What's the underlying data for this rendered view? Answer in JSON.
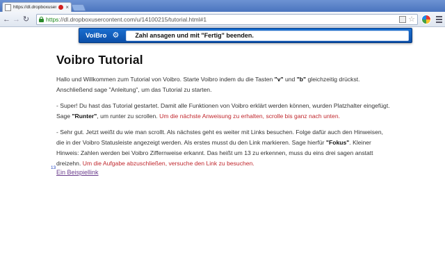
{
  "browser": {
    "tab_title": "https://dl.dropboxuser",
    "tab_close": "×",
    "url_https": "https",
    "url_rest": "://dl.dropboxusercontent.com/u/14100215/tutorial.html#1"
  },
  "voibro": {
    "logo": "VoiBro",
    "status": "Zahl ansagen und mit \"Fertig\" beenden."
  },
  "page": {
    "title": "Voibro Tutorial",
    "p1": {
      "t1": "Hallo und Willkommen zum Tutorial von Voibro. Starte Voibro indem du die Tasten ",
      "k1": "\"v\"",
      "t2": " und ",
      "k2": "\"b\"",
      "t3": " gleichzeitig drückst. Anschließend sage \"Anleitung\", um das Tutorial zu starten."
    },
    "p2": {
      "t1": "- Super! Du hast das Tutorial gestartet. Damit alle Funktionen von Voibro erklärt werden können, wurden Platzhalter eingefügt. Sage ",
      "k1": "\"Runter\"",
      "t2": ", um runter zu scrollen. ",
      "red": "Um die nächste Anweisung zu erhalten, scrolle bis ganz nach unten."
    },
    "p3": {
      "t1": "- Sehr gut. Jetzt weißt du wie man scrollt. Als nächstes geht es weiter mit Links besuchen. Folge dafür auch den Hinweisen, die in der Voibro Statusleiste angezeigt werden. Als erstes musst du den Link markieren. Sage hierfür ",
      "k1": "\"Fokus\"",
      "t2": ". Kleiner Hinweis: Zahlen werden bei Voibro Ziffernweise erkannt. Das heißt um 13 zu erkennen, muss du eins drei sagen anstatt dreizehn. ",
      "red": "Um die Aufgabe abzuschließen, versuche den Link zu besuchen."
    },
    "link_hint_number": "13",
    "example_link": "Ein Beispiellink"
  },
  "colors": {
    "voibro_bar": "#0c4fa8",
    "highlight_red": "#c0272d",
    "link_visited": "#6a3c8c"
  }
}
